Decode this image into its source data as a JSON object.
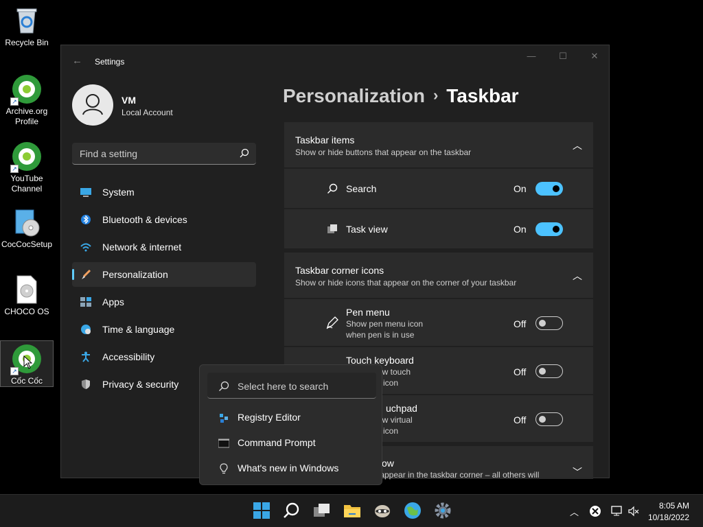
{
  "desktop": {
    "icons": [
      {
        "label": "Recycle Bin"
      },
      {
        "label": "Archive.org Profile"
      },
      {
        "label": "YouTube Channel"
      },
      {
        "label": "CocCocSetup"
      },
      {
        "label": "CHOCO OS"
      },
      {
        "label": "Cốc Cốc"
      }
    ]
  },
  "window": {
    "title": "Settings",
    "user": {
      "name": "VM",
      "account": "Local Account"
    },
    "search_placeholder": "Find a setting",
    "nav": [
      {
        "label": "System",
        "icon": "monitor-icon"
      },
      {
        "label": "Bluetooth & devices",
        "icon": "bluetooth-icon"
      },
      {
        "label": "Network & internet",
        "icon": "wifi-icon"
      },
      {
        "label": "Personalization",
        "icon": "brush-icon",
        "active": true
      },
      {
        "label": "Apps",
        "icon": "apps-icon"
      },
      {
        "label": "Time & language",
        "icon": "globe-clock-icon"
      },
      {
        "label": "Accessibility",
        "icon": "accessibility-icon"
      },
      {
        "label": "Privacy & security",
        "icon": "shield-icon"
      }
    ],
    "breadcrumb": {
      "parent": "Personalization",
      "separator": "›",
      "current": "Taskbar"
    },
    "sections": {
      "taskbar_items": {
        "title": "Taskbar items",
        "subtitle": "Show or hide buttons that appear on the taskbar",
        "rows": [
          {
            "label": "Search",
            "state": "On"
          },
          {
            "label": "Task view",
            "state": "On"
          }
        ]
      },
      "corner_icons": {
        "title": "Taskbar corner icons",
        "subtitle": "Show or hide icons that appear on the corner of your taskbar",
        "rows": [
          {
            "label": "Pen menu",
            "sub1": "Show pen menu icon",
            "sub2": "when pen is in use",
            "state": "Off"
          },
          {
            "label": "Touch keyboard",
            "sub1": "ow touch",
            "sub2": "icon",
            "state": "Off"
          },
          {
            "label": "uchpad",
            "sub1": "ow virtual",
            "sub2": "icon",
            "state": "Off"
          }
        ]
      },
      "overflow": {
        "title": "ow",
        "subtitle": "y appear in the taskbar corner – all others will"
      }
    }
  },
  "popup": {
    "search_placeholder": "Select here to search",
    "items": [
      {
        "label": "Registry Editor",
        "icon": "registry-editor-icon"
      },
      {
        "label": "Command Prompt",
        "icon": "command-prompt-icon"
      },
      {
        "label": "What's new in Windows",
        "icon": "lightbulb-icon"
      }
    ]
  },
  "taskbar": {
    "clock": {
      "time": "8:05 AM",
      "date": "10/18/2022"
    }
  },
  "colors": {
    "accent": "#4cc2ff",
    "window_bg": "#202020",
    "card_bg": "#2b2b2b"
  }
}
